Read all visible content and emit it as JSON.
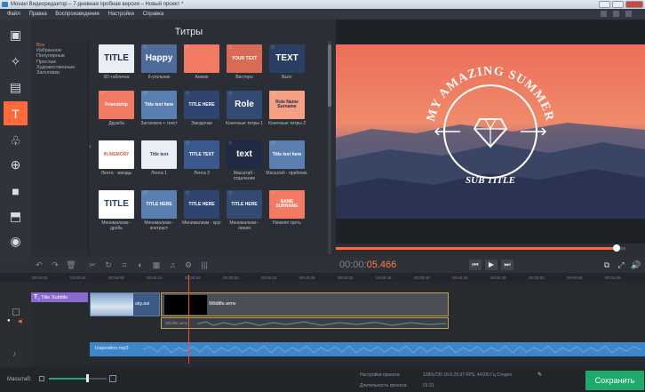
{
  "window": {
    "title": "Movavi Видеоредактор – 7-дневная пробная версия – Новый проект *"
  },
  "menu": [
    "Файл",
    "Правка",
    "Воспроизведение",
    "Настройки",
    "Справка"
  ],
  "panel": {
    "title": "Титры"
  },
  "categories": [
    "Все",
    "Избранное",
    "Популярные",
    "Простые",
    "Художественные",
    "Заголовки"
  ],
  "tiles": [
    {
      "label": "3D-табличка",
      "text": "TITLE"
    },
    {
      "label": "6-угольник",
      "text": "Happy"
    },
    {
      "label": "Аниме",
      "text": ""
    },
    {
      "label": "Вестерн",
      "text": "YOUR TEXT"
    },
    {
      "label": "Выхт",
      "text": "TEXT"
    },
    {
      "label": "Дружба",
      "text": "Friendship"
    },
    {
      "label": "Заголовок + текст",
      "text": "Title text here"
    },
    {
      "label": "Звездочки",
      "text": "TITLE HERE"
    },
    {
      "label": "Конечные титры 1",
      "text": "Role"
    },
    {
      "label": "Конечные титры 2",
      "text": "Role Name Surname"
    },
    {
      "label": "Лента - звезды",
      "text": "IN MEMORY"
    },
    {
      "label": "Лента 1",
      "text": "Title text"
    },
    {
      "label": "Лента 2",
      "text": "TITLE TEXT"
    },
    {
      "label": "Масштаб - отдаление",
      "text": "text"
    },
    {
      "label": "Масштаб - приближ.",
      "text": "Title text here"
    },
    {
      "label": "Минимализм - дробь",
      "text": "TITLE"
    },
    {
      "label": "Минимализм - контраст",
      "text": "TITLE HERE"
    },
    {
      "label": "Минимализм - круг",
      "text": "TITLE HERE"
    },
    {
      "label": "Минимализм - линия",
      "text": "TITLE HERE"
    },
    {
      "label": "Нижняя треть",
      "text": "NAME SURNAME"
    }
  ],
  "preview": {
    "top_text": "MY AMAZING SUMMER",
    "sub_text": "SUB TITLE"
  },
  "timecode": {
    "gray": "00:00:",
    "orange": "05.466"
  },
  "ruler": [
    "00:00:00",
    "00:00:04",
    "00:00:08",
    "00:00:12",
    "00:00:16",
    "00:00:20",
    "00:00:24",
    "00:00:28",
    "00:00:32",
    "00:00:36",
    "00:00:40",
    "00:00:44",
    "00:00:48",
    "00:00:52",
    "00:00:56",
    "00:01:00"
  ],
  "tracks": {
    "title_clip": "Title Subtitle",
    "clip1": "sky.avi",
    "clip2": "Wildlife.wmv",
    "audio_under": "Wildlife.wmv",
    "music": "Inspiration.mp3"
  },
  "bottom": {
    "zoom_label": "Масштаб:",
    "settings_label": "Настройки проекта:",
    "settings_value": "1280x720 16:9 29.97 FPS, 44100 Гц Стерео",
    "duration_label": "Длительность проекта:",
    "duration_value": "01:31",
    "save": "Сохранить"
  },
  "colors": {
    "accent": "#ff6a3d",
    "save": "#1eaa6a",
    "clip": "#8b6ad0"
  }
}
